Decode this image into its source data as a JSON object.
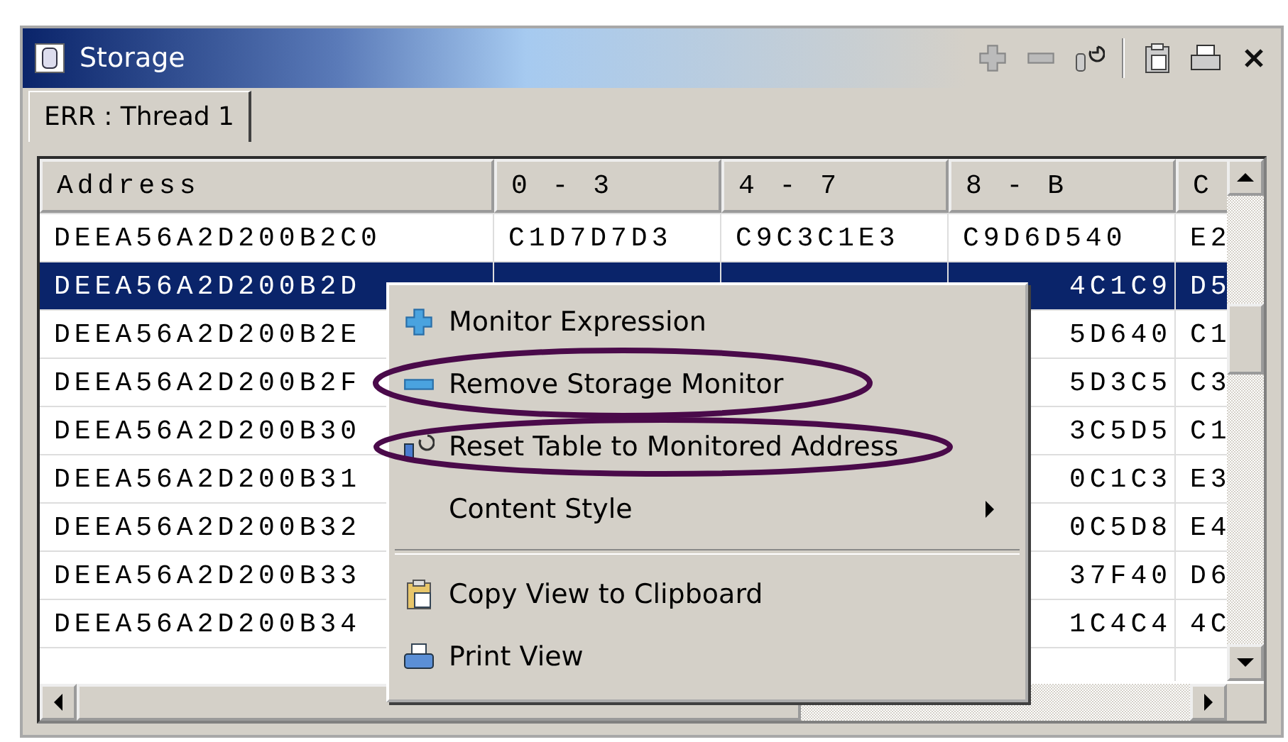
{
  "window": {
    "title": "Storage"
  },
  "tabs": [
    {
      "label": "ERR : Thread 1",
      "selected": true
    }
  ],
  "table": {
    "columns": [
      "Address",
      "0 - 3",
      "4 - 7",
      "8 - B",
      "C"
    ],
    "rows": [
      {
        "cells": [
          "DEEA56A2D200B2C0",
          "C1D7D7D3",
          "C9C3C1E3",
          "C9D6D540",
          "E2"
        ],
        "selected": false
      },
      {
        "cells": [
          "DEEA56A2D200B2D",
          null,
          null,
          "4C1C9",
          "D5"
        ],
        "selected": true
      },
      {
        "cells": [
          "DEEA56A2D200B2E",
          null,
          null,
          "5D640",
          "C1"
        ],
        "selected": false
      },
      {
        "cells": [
          "DEEA56A2D200B2F",
          null,
          null,
          "5D3C5",
          "C3"
        ],
        "selected": false
      },
      {
        "cells": [
          "DEEA56A2D200B30",
          null,
          null,
          "3C5D5",
          "C1"
        ],
        "selected": false
      },
      {
        "cells": [
          "DEEA56A2D200B31",
          null,
          null,
          "0C1C3",
          "E3"
        ],
        "selected": false
      },
      {
        "cells": [
          "DEEA56A2D200B32",
          null,
          null,
          "0C5D8",
          "E4"
        ],
        "selected": false
      },
      {
        "cells": [
          "DEEA56A2D200B33",
          null,
          null,
          "37F40",
          "D6"
        ],
        "selected": false
      },
      {
        "cells": [
          "DEEA56A2D200B34",
          null,
          null,
          "1C4C4",
          "4C"
        ],
        "selected": false
      }
    ]
  },
  "context_menu": [
    {
      "kind": "item",
      "label": "Monitor Expression"
    },
    {
      "kind": "item",
      "label": "Remove Storage Monitor"
    },
    {
      "kind": "item",
      "label": "Reset Table to Monitored Address"
    },
    {
      "kind": "submenu",
      "label": "Content Style"
    },
    {
      "kind": "separator"
    },
    {
      "kind": "item",
      "label": "Copy View to Clipboard"
    },
    {
      "kind": "item",
      "label": "Print View"
    }
  ]
}
